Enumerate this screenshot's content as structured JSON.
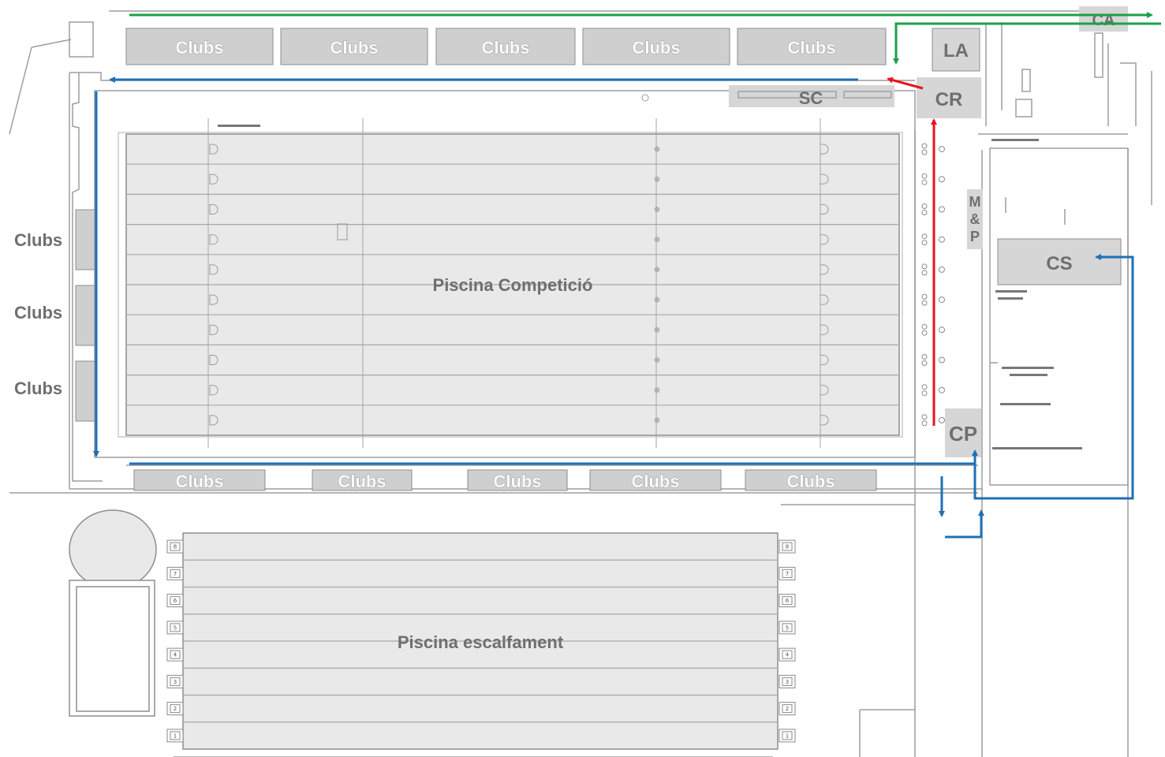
{
  "pools": {
    "competition": "Piscina Competició",
    "warmup": "Piscina escalfament"
  },
  "clubs": {
    "label": "Clubs"
  },
  "zones": {
    "ca": "CA",
    "la": "LA",
    "cr": "CR",
    "sc": "SC",
    "mp": [
      "M",
      "&",
      "P"
    ],
    "cs": "CS",
    "cp": "CP"
  },
  "warmup_lane_numbers": [
    "8",
    "7",
    "6",
    "5",
    "4",
    "3",
    "2",
    "1"
  ],
  "route_colors": {
    "green": "#1aa14a",
    "blue": "#1f6fb6",
    "red": "#e8141b"
  }
}
